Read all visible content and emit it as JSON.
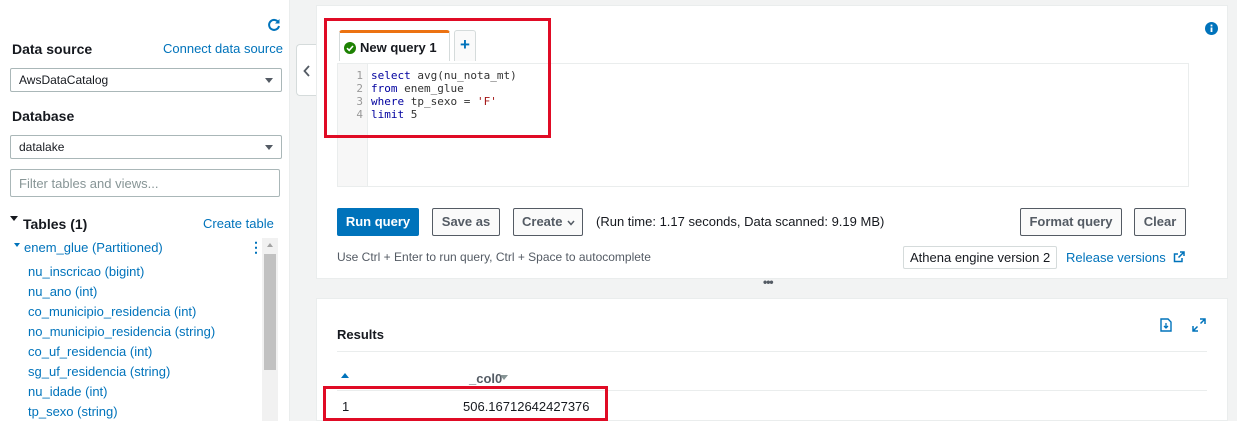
{
  "left": {
    "data_source_label": "Data source",
    "connect_link": "Connect data source",
    "data_source_value": "AwsDataCatalog",
    "database_label": "Database",
    "database_value": "datalake",
    "filter_placeholder": "Filter tables and views...",
    "tables_header": "Tables (1)",
    "create_table": "Create table",
    "table_name": "enem_glue (Partitioned)",
    "columns": [
      "nu_inscricao (bigint)",
      "nu_ano (int)",
      "co_municipio_residencia (int)",
      "no_municipio_residencia (string)",
      "co_uf_residencia (int)",
      "sg_uf_residencia (string)",
      "nu_idade (int)",
      "tp_sexo (string)"
    ]
  },
  "editor": {
    "tab_label": "New query 1",
    "add_tab": "+",
    "line_numbers": [
      "1",
      "2",
      "3",
      "4"
    ],
    "lines": [
      {
        "kw": "select",
        "rest": " avg(nu_nota_mt)",
        "str": ""
      },
      {
        "kw": "from",
        "rest": " enem_glue",
        "str": ""
      },
      {
        "kw": "where",
        "rest": " tp_sexo = ",
        "str": "'F'"
      },
      {
        "kw": "limit",
        "rest": " 5",
        "str": ""
      }
    ],
    "run_label": "Run query",
    "save_label": "Save as",
    "create_label": "Create",
    "run_stats": "(Run time: 1.17 seconds, Data scanned: 9.19 MB)",
    "format_label": "Format query",
    "clear_label": "Clear",
    "hint": "Use Ctrl + Enter to run query, Ctrl + Space to autocomplete",
    "engine": "Athena engine version 2",
    "release": "Release versions"
  },
  "results": {
    "title": "Results",
    "column": "_col0",
    "rows": [
      {
        "n": "1",
        "value": "506.16712642427376"
      }
    ]
  },
  "colors": {
    "accent": "#0073bb",
    "tab_top": "#ec7211",
    "highlight": "#e00b25",
    "success": "#1d8102"
  }
}
